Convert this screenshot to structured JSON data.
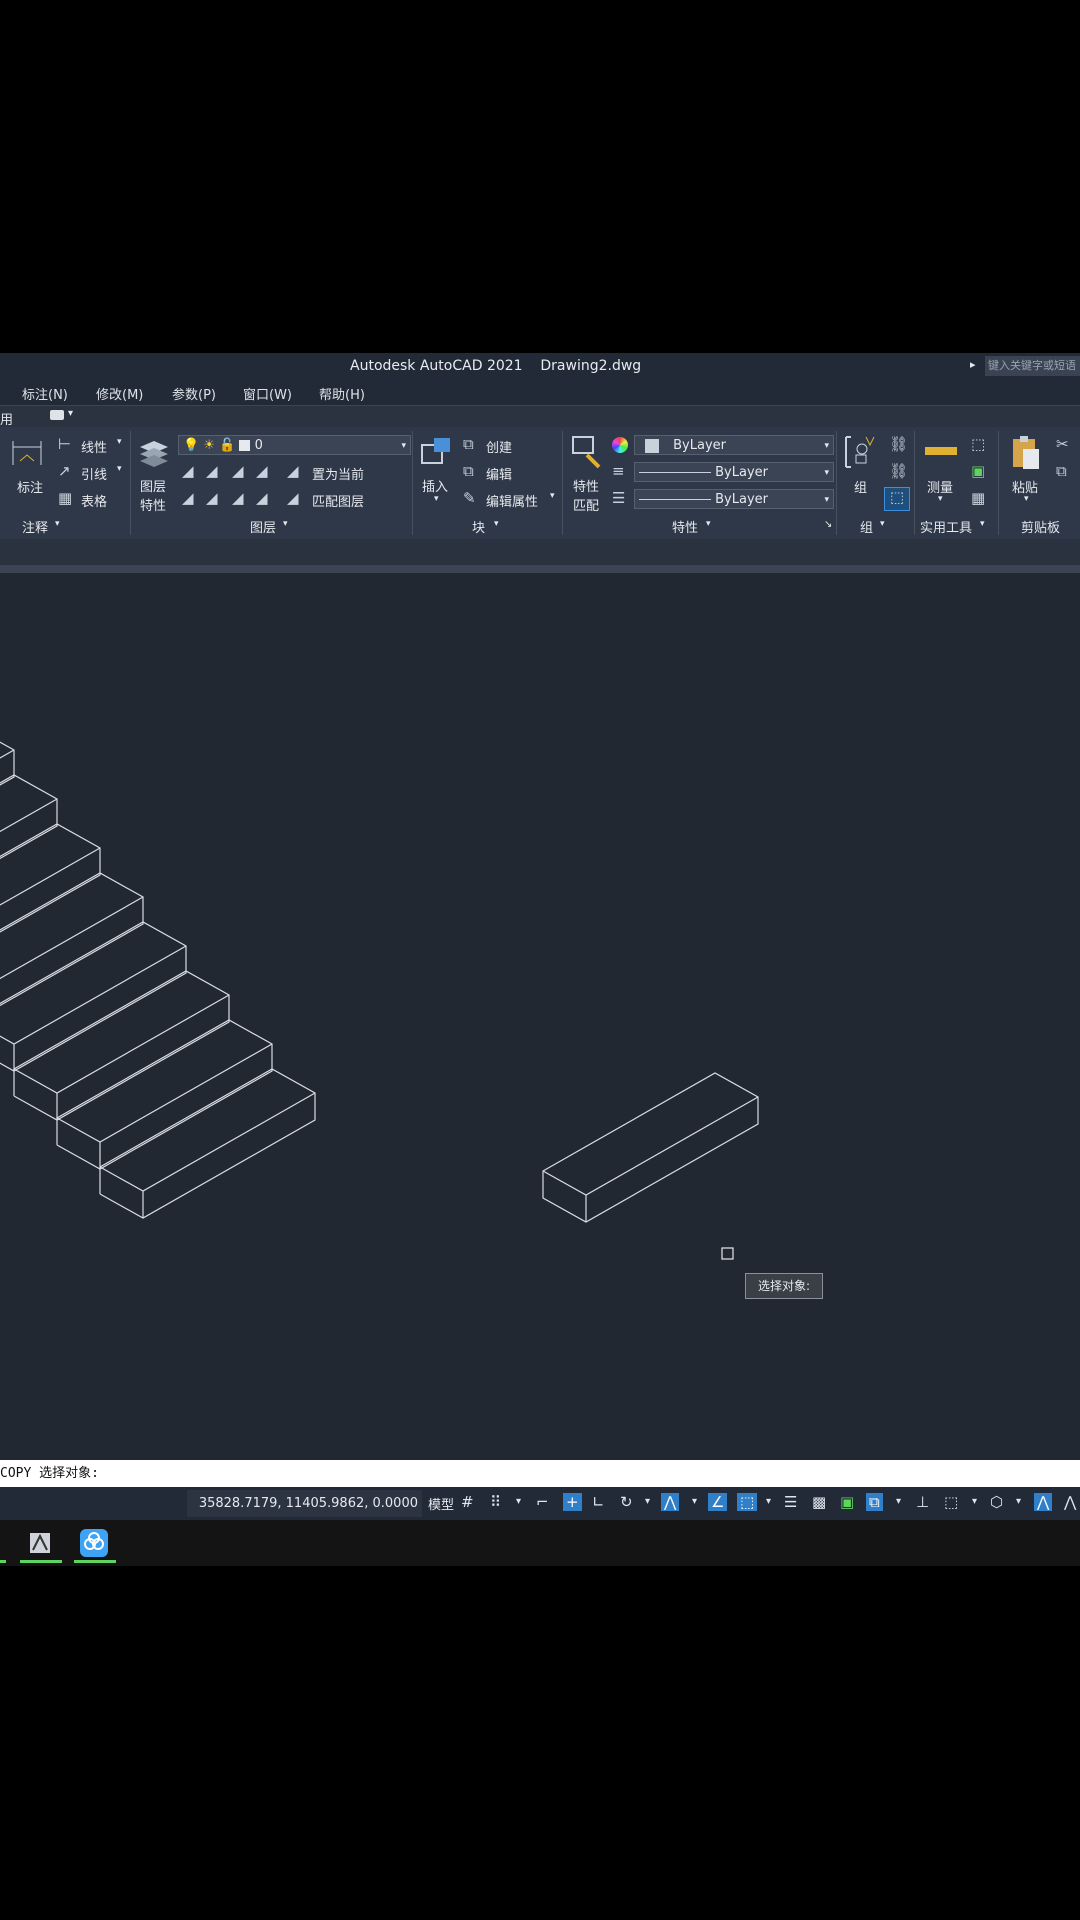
{
  "window": {
    "title": "Autodesk AutoCAD 2021    Drawing2.dwg",
    "search_placeholder": "键入关键字或短语"
  },
  "menu": [
    "标注(N)",
    "修改(M)",
    "参数(P)",
    "窗口(W)",
    "帮助(H)"
  ],
  "tab_partial": "用",
  "ribbon": {
    "annotate": {
      "big_label": "标注",
      "linear": "线性",
      "leader": "引线",
      "table": "表格",
      "title": "注释"
    },
    "layers": {
      "layer_props_1": "图层",
      "layer_props_2": "特性",
      "current_layer": "0",
      "set_current": "置为当前",
      "match_layer": "匹配图层",
      "title": "图层"
    },
    "block": {
      "insert": "插入",
      "create": "创建",
      "edit": "编辑",
      "edit_attr": "编辑属性",
      "title": "块"
    },
    "properties": {
      "match_1": "特性",
      "match_2": "匹配",
      "color": "ByLayer",
      "linetype": "ByLayer",
      "lineweight": "ByLayer",
      "title": "特性"
    },
    "groups": {
      "group": "组",
      "title": "组"
    },
    "utilities": {
      "measure": "测量",
      "title": "实用工具"
    },
    "clipboard": {
      "paste": "粘贴",
      "title": "剪贴板"
    }
  },
  "canvas": {
    "tooltip": "选择对象:"
  },
  "command_line": "COPY 选择对象:",
  "status": {
    "coordinates": "35828.7179, 11405.9862, 0.0000",
    "model": "模型"
  }
}
